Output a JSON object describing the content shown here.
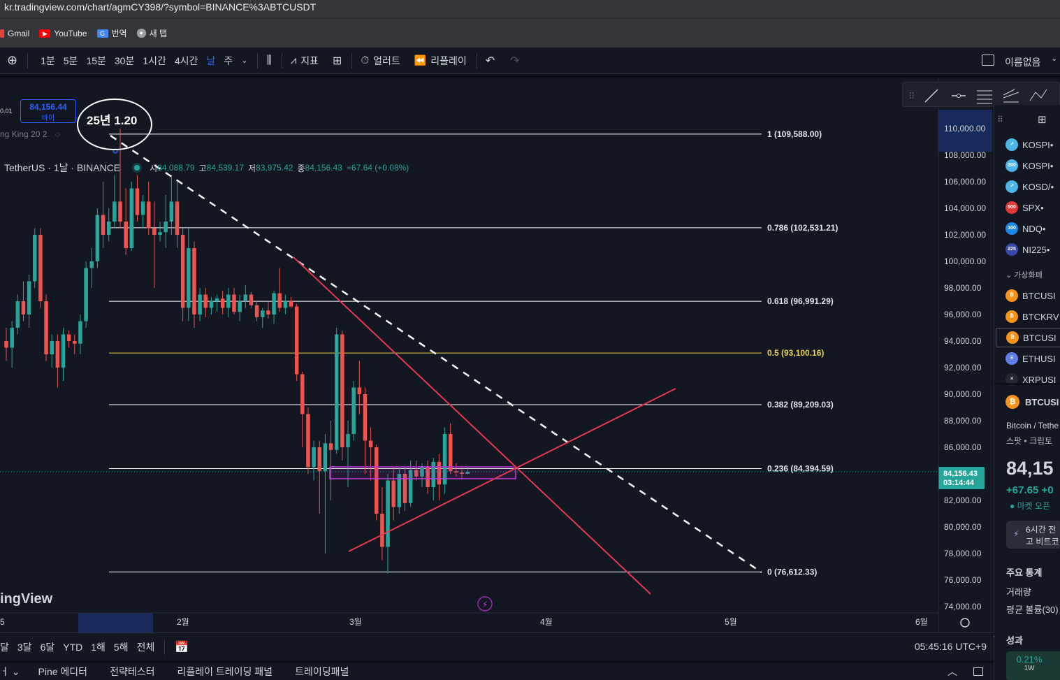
{
  "browser": {
    "url": "kr.tradingview.com/chart/agmCY398/?symbol=BINANCE%3ABTCUSDT"
  },
  "bookmarks": [
    {
      "label": "Gmail",
      "icon": "gmail-icon",
      "color": "#ea4335"
    },
    {
      "label": "YouTube",
      "icon": "youtube-icon",
      "color": "#ff0000"
    },
    {
      "label": "번역",
      "icon": "translate-icon",
      "color": "#4285f4"
    },
    {
      "label": "새 탭",
      "icon": "globe-icon",
      "color": "#9aa0a6"
    }
  ],
  "toolbar": {
    "intervals": [
      "1분",
      "5분",
      "15분",
      "30분",
      "1시간",
      "4시간",
      "날",
      "주"
    ],
    "active_interval": "날",
    "indicators": "지표",
    "alert": "얼러트",
    "replay": "리플레이",
    "layout_name": "이름없음"
  },
  "legend": {
    "symbol": "TetherUS · 1날 · BINANCE",
    "open_label": "시",
    "open": "84,088.79",
    "high_label": "고",
    "high": "84,539.17",
    "low_label": "저",
    "low": "83,975.42",
    "close_label": "종",
    "close": "84,156.43",
    "change": "+67.64 (+0.08%)",
    "buy_price": "84,156.44",
    "buy_label": "바이",
    "spread": "0.01",
    "indicator_name": "ng King 20 2"
  },
  "annotation": {
    "text": "25년 1.20"
  },
  "watermark": "ingView",
  "chart_data": {
    "type": "candlestick",
    "symbol": "BTCUSDT",
    "ylim": [
      73500,
      111500
    ],
    "y_ticks": [
      "110,000.00",
      "108,000.00",
      "106,000.00",
      "104,000.00",
      "102,000.00",
      "100,000.00",
      "98,000.00",
      "96,000.00",
      "94,000.00",
      "92,000.00",
      "90,000.00",
      "88,000.00",
      "86,000.00",
      "84,000.00",
      "82,000.00",
      "80,000.00",
      "78,000.00",
      "76,000.00",
      "74,000.00"
    ],
    "x_labels": [
      "2월",
      "3월",
      "4월",
      "5월",
      "6월"
    ],
    "last_price": "84,156.43",
    "countdown": "03:14:44",
    "fib_levels": [
      {
        "label": "1 (109,588.00)",
        "value": 109588,
        "color": "#ffffff"
      },
      {
        "label": "0.786 (102,531.21)",
        "value": 102531.21,
        "color": "#ffffff"
      },
      {
        "label": "0.618 (96,991.29)",
        "value": 96991.29,
        "color": "#ffffff"
      },
      {
        "label": "0.5 (93,100.16)",
        "value": 93100.16,
        "color": "#e8d44d"
      },
      {
        "label": "0.382 (89,209.03)",
        "value": 89209.03,
        "color": "#ffffff"
      },
      {
        "label": "0.236 (84,394.59)",
        "value": 84394.59,
        "color": "#ffffff"
      },
      {
        "label": "0 (76,612.33)",
        "value": 76612.33,
        "color": "#ffffff"
      }
    ],
    "candles": [
      [
        94000,
        95000,
        92500,
        93500
      ],
      [
        93500,
        95500,
        92000,
        95000
      ],
      [
        95000,
        97500,
        94500,
        97000
      ],
      [
        97000,
        98500,
        95500,
        96000
      ],
      [
        96000,
        99000,
        95000,
        98500
      ],
      [
        98500,
        102500,
        98000,
        102000
      ],
      [
        102000,
        102500,
        96500,
        97000
      ],
      [
        97000,
        97500,
        92500,
        93000
      ],
      [
        93000,
        94500,
        92000,
        94000
      ],
      [
        94000,
        94500,
        90500,
        92000
      ],
      [
        92000,
        95000,
        91000,
        94500
      ],
      [
        94500,
        94800,
        93500,
        94000
      ],
      [
        94000,
        94500,
        93000,
        93800
      ],
      [
        93800,
        96000,
        93000,
        95500
      ],
      [
        95500,
        100000,
        95000,
        99500
      ],
      [
        99500,
        101000,
        98000,
        100000
      ],
      [
        100000,
        104000,
        99500,
        103500
      ],
      [
        103500,
        106000,
        101000,
        102000
      ],
      [
        102000,
        104000,
        101500,
        103000
      ],
      [
        103000,
        106500,
        102500,
        104500
      ],
      [
        104500,
        110000,
        102500,
        103000
      ],
      [
        103000,
        105500,
        100500,
        101000
      ],
      [
        101000,
        106000,
        100800,
        105500
      ],
      [
        105500,
        106500,
        103000,
        103500
      ],
      [
        103500,
        105000,
        102500,
        104500
      ],
      [
        104500,
        106000,
        102000,
        102500
      ],
      [
        102500,
        104500,
        98000,
        102000
      ],
      [
        102000,
        103000,
        101500,
        102200
      ],
      [
        102200,
        105000,
        101000,
        103000
      ],
      [
        103000,
        106500,
        102000,
        104500
      ],
      [
        104500,
        106000,
        101000,
        102000
      ],
      [
        102000,
        102500,
        95500,
        96500
      ],
      [
        96500,
        102500,
        95500,
        101000
      ],
      [
        101000,
        101500,
        95000,
        96000
      ],
      [
        96000,
        98000,
        95500,
        97500
      ],
      [
        97500,
        98000,
        95800,
        96500
      ],
      [
        96500,
        97300,
        96000,
        97000
      ],
      [
        97000,
        97500,
        96200,
        97200
      ],
      [
        97200,
        97800,
        96000,
        96500
      ],
      [
        96500,
        98000,
        95800,
        97500
      ],
      [
        97500,
        98000,
        96000,
        96200
      ],
      [
        96200,
        97500,
        95500,
        97000
      ],
      [
        97000,
        98200,
        96500,
        97500
      ],
      [
        97500,
        97700,
        96500,
        96700
      ],
      [
        96700,
        97000,
        95500,
        95800
      ],
      [
        95800,
        96500,
        95000,
        96300
      ],
      [
        96300,
        97000,
        95700,
        96000
      ],
      [
        96000,
        97800,
        95300,
        97600
      ],
      [
        97600,
        99500,
        96200,
        96500
      ],
      [
        96500,
        97500,
        96000,
        97000
      ],
      [
        97000,
        97300,
        96500,
        96600
      ],
      [
        96600,
        96800,
        91000,
        91500
      ],
      [
        91500,
        91700,
        86000,
        88500
      ],
      [
        88500,
        89000,
        84000,
        84500
      ],
      [
        84500,
        86500,
        83500,
        86000
      ],
      [
        86000,
        86500,
        81000,
        84200
      ],
      [
        84200,
        87000,
        78000,
        86300
      ],
      [
        86300,
        88000,
        82000,
        85800
      ],
      [
        85800,
        95000,
        85500,
        94500
      ],
      [
        94500,
        94800,
        85000,
        86000
      ],
      [
        86000,
        88000,
        83000,
        87000
      ],
      [
        87000,
        91000,
        86500,
        90500
      ],
      [
        90500,
        92500,
        88500,
        90000
      ],
      [
        90000,
        90500,
        84000,
        86500
      ],
      [
        86500,
        87500,
        83500,
        86000
      ],
      [
        86000,
        86200,
        80500,
        81000
      ],
      [
        81000,
        83000,
        77500,
        78500
      ],
      [
        78500,
        84000,
        76500,
        83500
      ],
      [
        83500,
        84500,
        80500,
        81500
      ],
      [
        81500,
        84500,
        81000,
        84000
      ],
      [
        84000,
        84500,
        81200,
        81800
      ],
      [
        81800,
        85000,
        81500,
        84300
      ],
      [
        84300,
        85000,
        83500,
        83800
      ],
      [
        83800,
        84800,
        83000,
        84500
      ],
      [
        84500,
        85000,
        82500,
        83000
      ],
      [
        83000,
        85200,
        82000,
        84900
      ],
      [
        84900,
        85500,
        82000,
        83200
      ],
      [
        83200,
        87500,
        82500,
        87000
      ],
      [
        87000,
        87800,
        84000,
        84200
      ],
      [
        84200,
        84800,
        83800,
        84100
      ],
      [
        84100,
        84600,
        83600,
        84000
      ],
      [
        84000,
        84540,
        83970,
        84156
      ]
    ]
  },
  "watchlist": {
    "items": [
      {
        "label": "KOSPI",
        "badge": "",
        "color": "#4db6e8",
        "dot": true
      },
      {
        "label": "KOSPI",
        "badge": "200",
        "color": "#4db6e8",
        "dot": true
      },
      {
        "label": "KOSD/",
        "badge": "",
        "color": "#4db6e8",
        "dot": true
      },
      {
        "label": "SPX",
        "badge": "500",
        "color": "#e53935",
        "dot": true
      },
      {
        "label": "NDQ",
        "badge": "100",
        "color": "#1e88e5",
        "dot": true
      },
      {
        "label": "NI225",
        "badge": "225",
        "color": "#3949ab",
        "dot": true
      }
    ],
    "section": "가상화폐",
    "crypto": [
      {
        "label": "BTCUSI",
        "badge": "₿",
        "color": "#f7931a"
      },
      {
        "label": "BTCKRV",
        "badge": "₿",
        "color": "#f7931a"
      },
      {
        "label": "BTCUSI",
        "badge": "₿",
        "color": "#f7931a"
      },
      {
        "label": "ETHUSI",
        "badge": "Ξ",
        "color": "#627eea"
      },
      {
        "label": "XRPUSI",
        "badge": "✕",
        "color": "#23292f"
      }
    ],
    "detail": {
      "symbol": "BTCUSI",
      "name": "Bitcoin / Tethe",
      "type": "스팟 • 크립토",
      "price": "84,15",
      "change": "+67.65 +0",
      "status": "마켓 오픈",
      "news": "6시간 전",
      "news2": "고 비트코",
      "stats": "주요 통계",
      "volume": "거래량",
      "avg_volume": "평균 볼륨(30)",
      "perf": "성과",
      "perf_value": "0.21%",
      "perf_period": "1W"
    }
  },
  "bottom": {
    "ranges": [
      "달",
      "3달",
      "6달",
      "YTD",
      "1해",
      "5해",
      "전체"
    ],
    "time": "05:45:16 UTC+9"
  },
  "footer": {
    "tabs": [
      "Pine 에디터",
      "전략테스터",
      "리플레이 트레이딩 패널",
      "트레이딩패널"
    ]
  }
}
